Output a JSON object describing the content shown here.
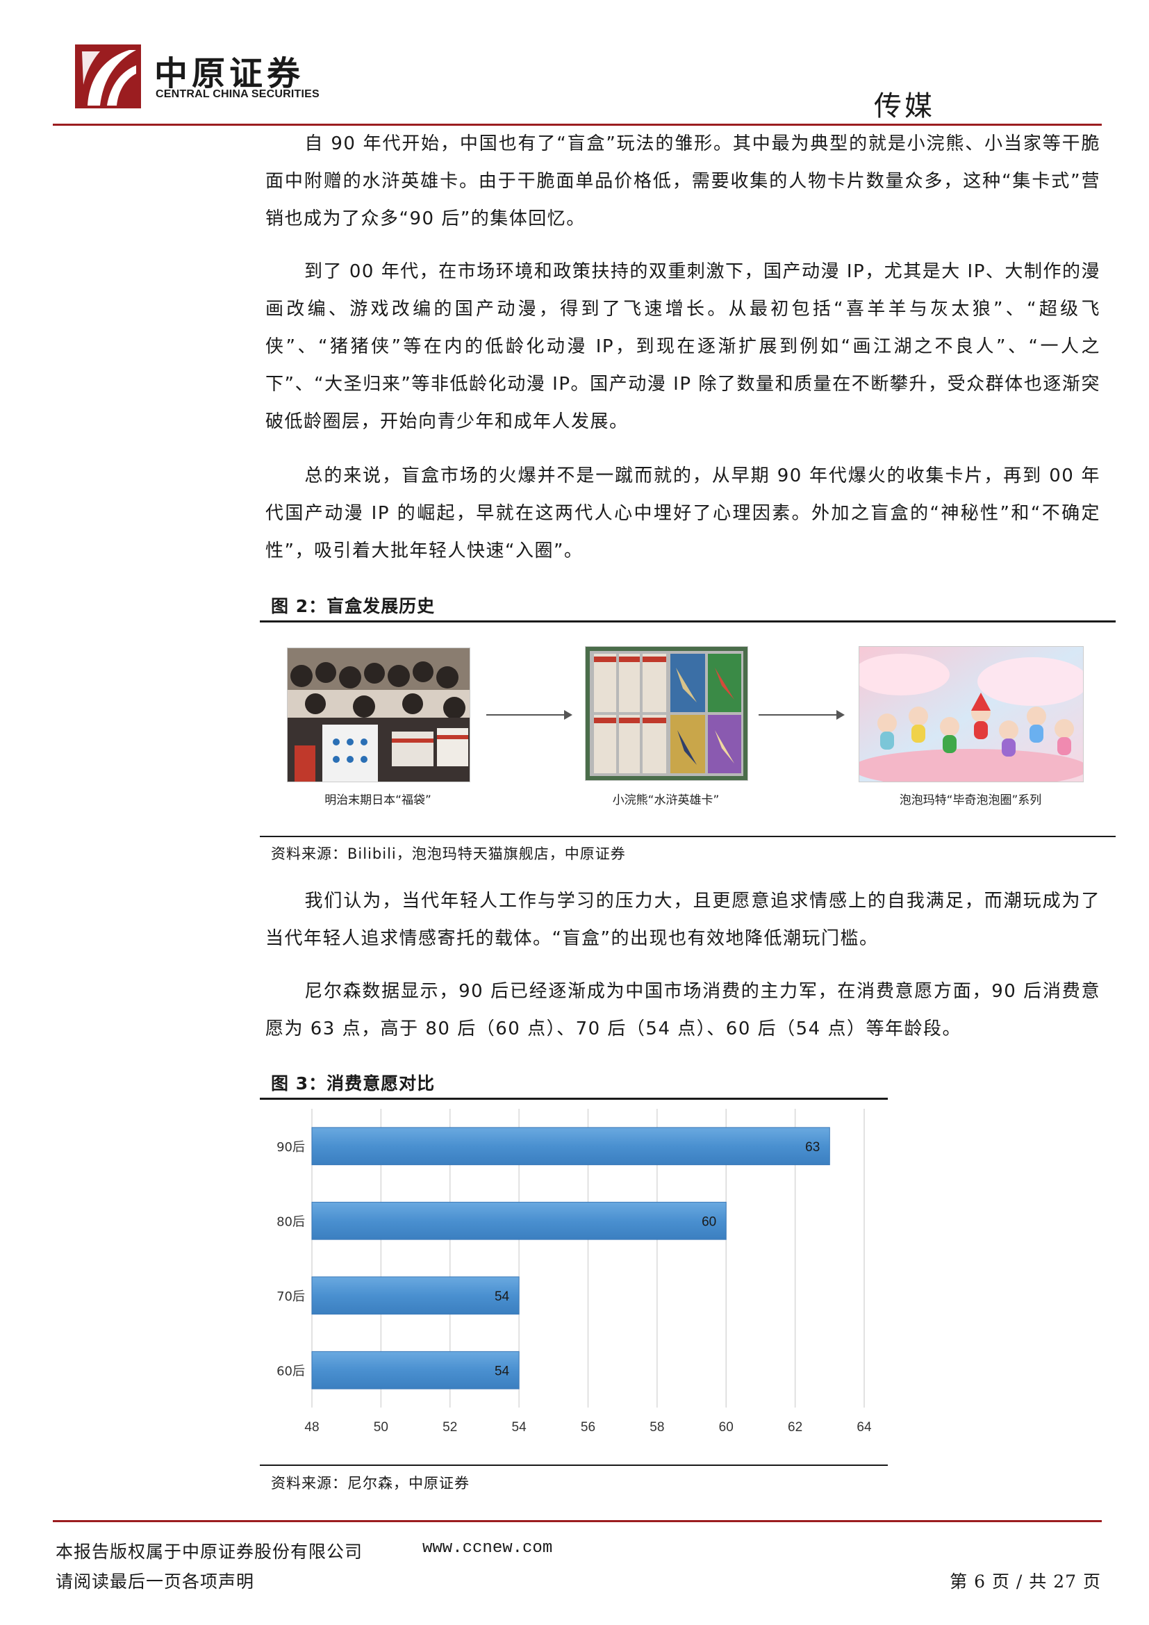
{
  "header": {
    "brand_cn": "中原证券",
    "brand_en": "CENTRAL CHINA SECURITIES",
    "industry": "传媒",
    "brand_color": "#9b1d20"
  },
  "body": {
    "p1": "自 90 年代开始，中国也有了“盲盒”玩法的雏形。其中最为典型的就是小浣熊、小当家等干脆面中附赠的水浒英雄卡。由于干脆面单品价格低，需要收集的人物卡片数量众多，这种“集卡式”营销也成为了众多“90 后”的集体回忆。",
    "p2": "到了 00 年代，在市场环境和政策扶持的双重刺激下，国产动漫 IP，尤其是大 IP、大制作的漫画改编、游戏改编的国产动漫，得到了飞速增长。从最初包括“喜羊羊与灰太狼”、“超级飞侠”、“猪猪侠”等在内的低龄化动漫 IP，到现在逐渐扩展到例如“画江湖之不良人”、“一人之下”、“大圣归来”等非低龄化动漫 IP。国产动漫 IP 除了数量和质量在不断攀升，受众群体也逐渐突破低龄圈层，开始向青少年和成年人发展。",
    "p3": "总的来说，盲盒市场的火爆并不是一蹴而就的，从早期 90 年代爆火的收集卡片，再到 00 年代国产动漫 IP 的崛起，早就在这两代人心中埋好了心理因素。外加之盲盒的“神秘性”和“不确定性”，吸引着大批年轻人快速“入圈”。",
    "p4": "我们认为，当代年轻人工作与学习的压力大，且更愿意追求情感上的自我满足，而潮玩成为了当代年轻人追求情感寄托的载体。“盲盒”的出现也有效地降低潮玩门槛。",
    "p5": "尼尔森数据显示，90 后已经逐渐成为中国市场消费的主力军，在消费意愿方面，90 后消费意愿为 63 点，高于 80 后（60 点）、70 后（54 点）、60 后（54 点）等年龄段。"
  },
  "figure2": {
    "title": "图 2：盲盒发展历史",
    "captions": [
      "明治末期日本“福袋”",
      "小浣熊“水浒英雄卡”",
      "泡泡玛特“毕奇泡泡圈”系列"
    ],
    "source": "资料来源：Bilibili，泡泡玛特天猫旗舰店，中原证券"
  },
  "figure3": {
    "title": "图 3：消费意愿对比",
    "source": "资料来源：尼尔森，中原证券"
  },
  "chart_data": {
    "type": "bar",
    "orientation": "horizontal",
    "categories": [
      "90后",
      "80后",
      "70后",
      "60后"
    ],
    "values": [
      63,
      60,
      54,
      54
    ],
    "xlim": [
      48,
      64
    ],
    "xticks": [
      48,
      50,
      52,
      54,
      56,
      58,
      60,
      62,
      64
    ],
    "grid": true,
    "bar_color": "#4a90d0",
    "data_labels": true
  },
  "footer": {
    "copyright": "本报告版权属于中原证券股份有限公司",
    "url": "www.ccnew.com",
    "disclaimer": "请阅读最后一页各项声明",
    "page": "第 6 页 / 共 27 页"
  }
}
